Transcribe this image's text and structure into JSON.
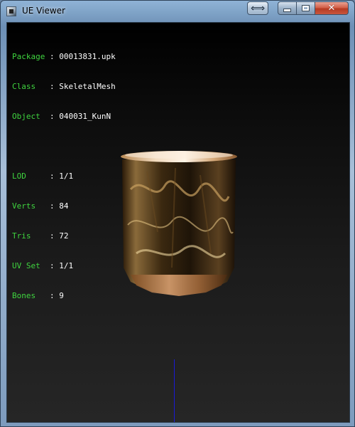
{
  "window": {
    "title": "UE Viewer"
  },
  "info": [
    {
      "key": "Package",
      "sep": " : ",
      "value": "00013831.upk"
    },
    {
      "key": "Class  ",
      "sep": " : ",
      "value": "SkeletalMesh"
    },
    {
      "key": "Object ",
      "sep": " : ",
      "value": "040031_KunN"
    },
    {
      "key": "LOD    ",
      "sep": " : ",
      "value": "1/1"
    },
    {
      "key": "Verts  ",
      "sep": " : ",
      "value": "84"
    },
    {
      "key": "Tris   ",
      "sep": " : ",
      "value": "72"
    },
    {
      "key": "UV Set ",
      "sep": " : ",
      "value": "1/1"
    },
    {
      "key": "Bones  ",
      "sep": " : ",
      "value": "9"
    }
  ],
  "colors": {
    "label": "#3fd43f",
    "value": "#ffffff",
    "axis": "#1a1ad6"
  }
}
